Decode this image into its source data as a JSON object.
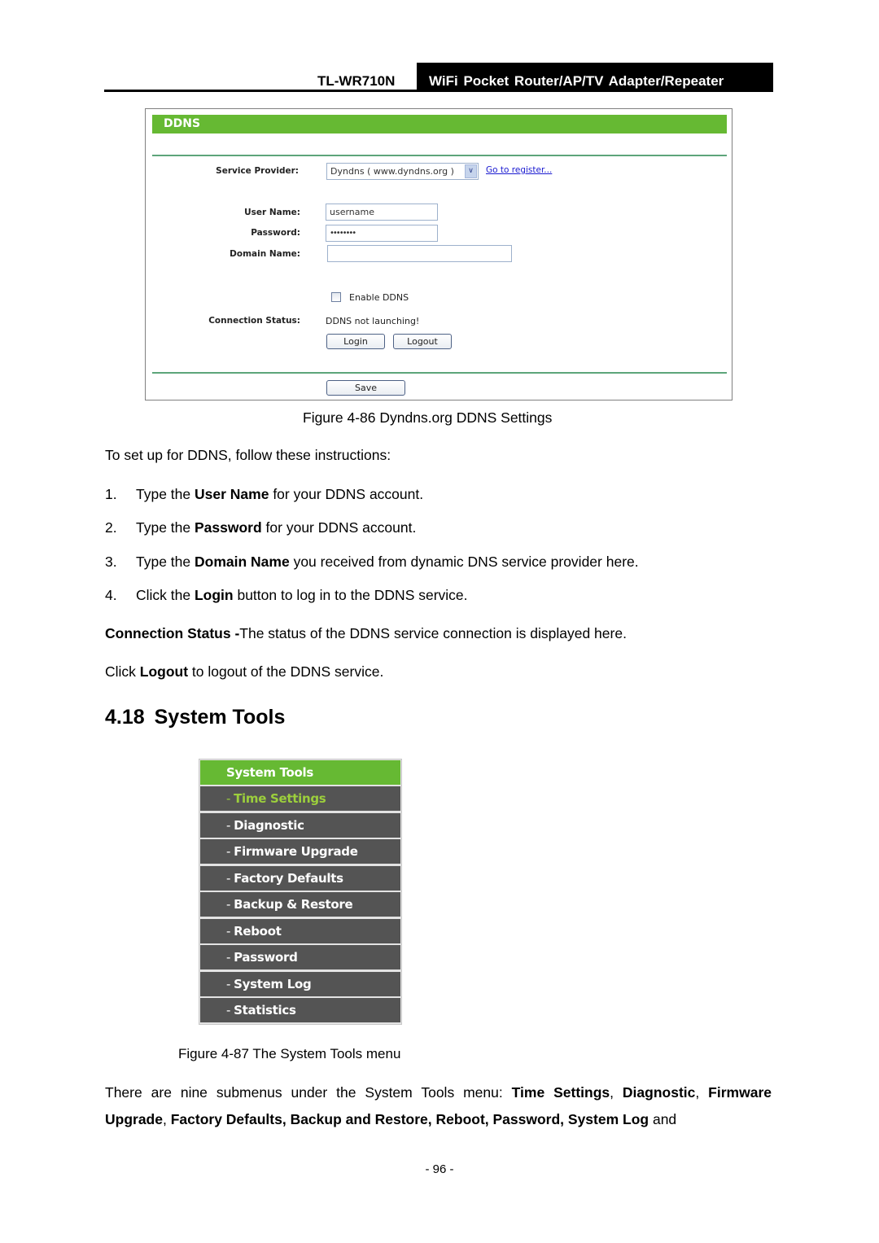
{
  "header": {
    "model": "TL-WR710N",
    "product": "WiFi Pocket Router/AP/TV Adapter/Repeater"
  },
  "ddns_figure": {
    "title": "DDNS",
    "service_provider_label": "Service Provider:",
    "service_provider_value": "Dyndns ( www.dyndns.org )",
    "register_link": "Go to register...",
    "user_name_label": "User Name:",
    "user_name_value": "username",
    "password_label": "Password:",
    "password_value": "••••••••",
    "domain_name_label": "Domain Name:",
    "domain_name_value": "",
    "enable_ddns_label": "Enable DDNS",
    "enable_ddns_checked": false,
    "connection_status_label": "Connection Status:",
    "connection_status_value": "DDNS not launching!",
    "login_button": "Login",
    "logout_button": "Logout",
    "save_button": "Save",
    "caption": "Figure 4-86 Dyndns.org DDNS Settings"
  },
  "instructions": {
    "intro": "To set up for DDNS, follow these instructions:",
    "steps": [
      {
        "num": "1.",
        "pre": "Type the ",
        "bold": "User Name",
        "post": " for your DDNS account."
      },
      {
        "num": "2.",
        "pre": "Type the ",
        "bold": "Password",
        "post": " for your DDNS account."
      },
      {
        "num": "3.",
        "pre": "Type the ",
        "bold": "Domain Name",
        "post": " you received from dynamic DNS service provider here."
      },
      {
        "num": "4.",
        "pre": "Click the ",
        "bold": "Login",
        "post": " button to log in to the DDNS service."
      }
    ],
    "connection_status_bold": "Connection Status -",
    "connection_status_text": "The status of the DDNS service connection is displayed here.",
    "logout_pre": "Click ",
    "logout_bold": "Logout",
    "logout_post": " to logout of the DDNS service."
  },
  "section": {
    "number": "4.18",
    "title": "System Tools"
  },
  "system_tools_menu": {
    "title": "System Tools",
    "items": [
      {
        "label": "Time Settings",
        "active": true
      },
      {
        "label": "Diagnostic",
        "active": false
      },
      {
        "label": "Firmware Upgrade",
        "active": false
      },
      {
        "label": "Factory Defaults",
        "active": false
      },
      {
        "label": "Backup & Restore",
        "active": false
      },
      {
        "label": "Reboot",
        "active": false
      },
      {
        "label": "Password",
        "active": false
      },
      {
        "label": "System Log",
        "active": false
      },
      {
        "label": "Statistics",
        "active": false
      }
    ],
    "caption": "Figure 4-87 The System Tools menu"
  },
  "summary": {
    "pre": "There are nine submenus under the System Tools menu: ",
    "b1": "Time Settings",
    "s1": ", ",
    "b2": "Diagnostic",
    "s2": ", ",
    "b3": "Firmware Upgrade",
    "s3": ", ",
    "b4": "Factory Defaults, Backup and Restore, Reboot, Password, System Log",
    "post": " and"
  },
  "footer": {
    "page_number": "- 96 -"
  },
  "colors": {
    "green_header": "#66b933",
    "menu_item_bg": "#545454",
    "menu_active_text": "#9ccf3c",
    "link": "#1a1ad0"
  }
}
